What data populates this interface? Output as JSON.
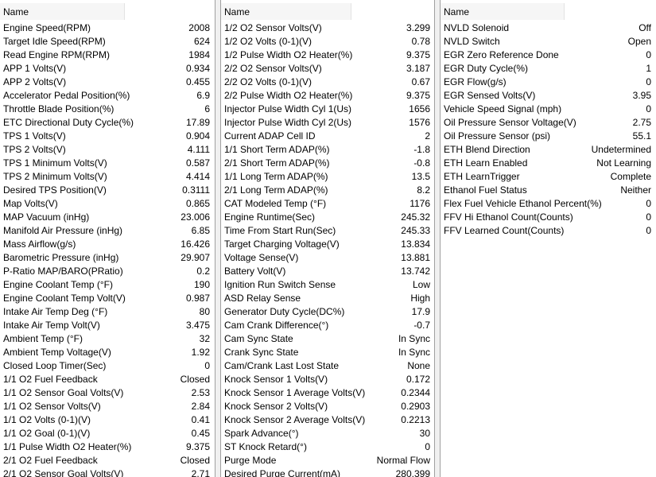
{
  "columns": {
    "name_header": "Name"
  },
  "panel1": [
    {
      "name": "Engine Speed(RPM)",
      "value": "2008"
    },
    {
      "name": "Target Idle Speed(RPM)",
      "value": "624"
    },
    {
      "name": "Read Engine RPM(RPM)",
      "value": "1984"
    },
    {
      "name": "APP 1 Volts(V)",
      "value": "0.934"
    },
    {
      "name": "APP 2 Volts(V)",
      "value": "0.455"
    },
    {
      "name": "Accelerator Pedal Position(%)",
      "value": "6.9"
    },
    {
      "name": "Throttle Blade Position(%)",
      "value": "6"
    },
    {
      "name": "ETC Directional Duty Cycle(%)",
      "value": "17.89"
    },
    {
      "name": "TPS 1 Volts(V)",
      "value": "0.904"
    },
    {
      "name": "TPS 2 Volts(V)",
      "value": "4.111"
    },
    {
      "name": "TPS 1 Minimum Volts(V)",
      "value": "0.587"
    },
    {
      "name": "TPS 2 Minimum Volts(V)",
      "value": "4.414"
    },
    {
      "name": "Desired TPS Position(V)",
      "value": "0.3111"
    },
    {
      "name": "Map Volts(V)",
      "value": "0.865"
    },
    {
      "name": "MAP Vacuum (inHg)",
      "value": "23.006"
    },
    {
      "name": "Manifold Air Pressure (inHg)",
      "value": "6.85"
    },
    {
      "name": "Mass Airflow(g/s)",
      "value": "16.426"
    },
    {
      "name": "Barometric Pressure (inHg)",
      "value": "29.907"
    },
    {
      "name": "P-Ratio MAP/BARO(PRatio)",
      "value": "0.2"
    },
    {
      "name": "Engine Coolant Temp (°F)",
      "value": "190"
    },
    {
      "name": "Engine Coolant Temp Volt(V)",
      "value": "0.987"
    },
    {
      "name": "Intake Air Temp Deg (°F)",
      "value": "80"
    },
    {
      "name": "Intake Air Temp Volt(V)",
      "value": "3.475"
    },
    {
      "name": "Ambient Temp (°F)",
      "value": "32"
    },
    {
      "name": "Ambient Temp Voltage(V)",
      "value": "1.92"
    },
    {
      "name": "Closed Loop Timer(Sec)",
      "value": "0"
    },
    {
      "name": "1/1 O2 Fuel Feedback",
      "value": "Closed"
    },
    {
      "name": "1/1 O2 Sensor Goal Volts(V)",
      "value": "2.53"
    },
    {
      "name": "1/1 O2 Sensor Volts(V)",
      "value": "2.84"
    },
    {
      "name": "1/1 O2 Volts (0-1)(V)",
      "value": "0.41"
    },
    {
      "name": "1/1 O2 Goal (0-1)(V)",
      "value": "0.45"
    },
    {
      "name": "1/1 Pulse Width O2 Heater(%)",
      "value": "9.375"
    },
    {
      "name": "2/1 O2 Fuel Feedback",
      "value": "Closed"
    },
    {
      "name": "2/1 O2 Sensor Goal Volts(V)",
      "value": "2.71"
    }
  ],
  "panel2": [
    {
      "name": "1/2 O2 Sensor Volts(V)",
      "value": "3.299"
    },
    {
      "name": "1/2 O2 Volts (0-1)(V)",
      "value": "0.78"
    },
    {
      "name": "1/2 Pulse Width O2 Heater(%)",
      "value": "9.375"
    },
    {
      "name": "2/2 O2 Sensor Volts(V)",
      "value": "3.187"
    },
    {
      "name": "2/2 O2 Volts (0-1)(V)",
      "value": "0.67"
    },
    {
      "name": "2/2 Pulse Width O2 Heater(%)",
      "value": "9.375"
    },
    {
      "name": "Injector Pulse Width Cyl 1(Us)",
      "value": "1656"
    },
    {
      "name": "Injector Pulse Width Cyl 2(Us)",
      "value": "1576"
    },
    {
      "name": "Current ADAP Cell ID",
      "value": "2"
    },
    {
      "name": "1/1 Short Term ADAP(%)",
      "value": "-1.8"
    },
    {
      "name": "2/1 Short Term ADAP(%)",
      "value": "-0.8"
    },
    {
      "name": "1/1 Long Term ADAP(%)",
      "value": "13.5"
    },
    {
      "name": "2/1 Long Term ADAP(%)",
      "value": "8.2"
    },
    {
      "name": "CAT Modeled Temp (°F)",
      "value": "1176"
    },
    {
      "name": "Engine Runtime(Sec)",
      "value": "245.32"
    },
    {
      "name": "Time From Start Run(Sec)",
      "value": "245.33"
    },
    {
      "name": "Target Charging Voltage(V)",
      "value": "13.834"
    },
    {
      "name": "Voltage Sense(V)",
      "value": "13.881"
    },
    {
      "name": "Battery Volt(V)",
      "value": "13.742"
    },
    {
      "name": "Ignition Run Switch Sense",
      "value": "Low"
    },
    {
      "name": "ASD Relay Sense",
      "value": "High"
    },
    {
      "name": "Generator Duty Cycle(DC%)",
      "value": "17.9"
    },
    {
      "name": "Cam Crank Difference(°)",
      "value": "-0.7"
    },
    {
      "name": "Cam Sync State",
      "value": "In Sync"
    },
    {
      "name": "Crank Sync State",
      "value": "In Sync"
    },
    {
      "name": "Cam/Crank Last Lost State",
      "value": "None"
    },
    {
      "name": "Knock Sensor 1 Volts(V)",
      "value": "0.172"
    },
    {
      "name": "Knock Sensor 1 Average Volts(V)",
      "value": "0.2344"
    },
    {
      "name": "Knock Sensor 2 Volts(V)",
      "value": "0.2903"
    },
    {
      "name": "Knock Sensor 2 Average Volts(V)",
      "value": "0.2213"
    },
    {
      "name": "Spark Advance(°)",
      "value": "30"
    },
    {
      "name": "ST Knock Retard(°)",
      "value": "0"
    },
    {
      "name": "Purge Mode",
      "value": "Normal Flow"
    },
    {
      "name": "Desired Purge Current(mA)",
      "value": "280.399"
    }
  ],
  "panel3": [
    {
      "name": "NVLD Solenoid",
      "value": "Off"
    },
    {
      "name": "NVLD Switch",
      "value": "Open"
    },
    {
      "name": "EGR Zero Reference Done",
      "value": "0"
    },
    {
      "name": "EGR Duty Cycle(%)",
      "value": "1"
    },
    {
      "name": "EGR Flow(g/s)",
      "value": "0"
    },
    {
      "name": "EGR Sensed Volts(V)",
      "value": "3.95"
    },
    {
      "name": "Vehicle Speed Signal (mph)",
      "value": "0"
    },
    {
      "name": "Oil Pressure Sensor Voltage(V)",
      "value": "2.75"
    },
    {
      "name": "Oil Pressure Sensor (psi)",
      "value": "55.1"
    },
    {
      "name": "ETH Blend Direction",
      "value": "Undetermined"
    },
    {
      "name": "ETH Learn Enabled",
      "value": "Not Learning"
    },
    {
      "name": "ETH LearnTrigger",
      "value": "Complete"
    },
    {
      "name": "Ethanol Fuel Status",
      "value": "Neither"
    },
    {
      "name": "Flex Fuel Vehicle Ethanol Percent(%)",
      "value": "0"
    },
    {
      "name": "FFV Hi Ethanol Count(Counts)",
      "value": "0"
    },
    {
      "name": "FFV Learned Count(Counts)",
      "value": "0"
    }
  ]
}
